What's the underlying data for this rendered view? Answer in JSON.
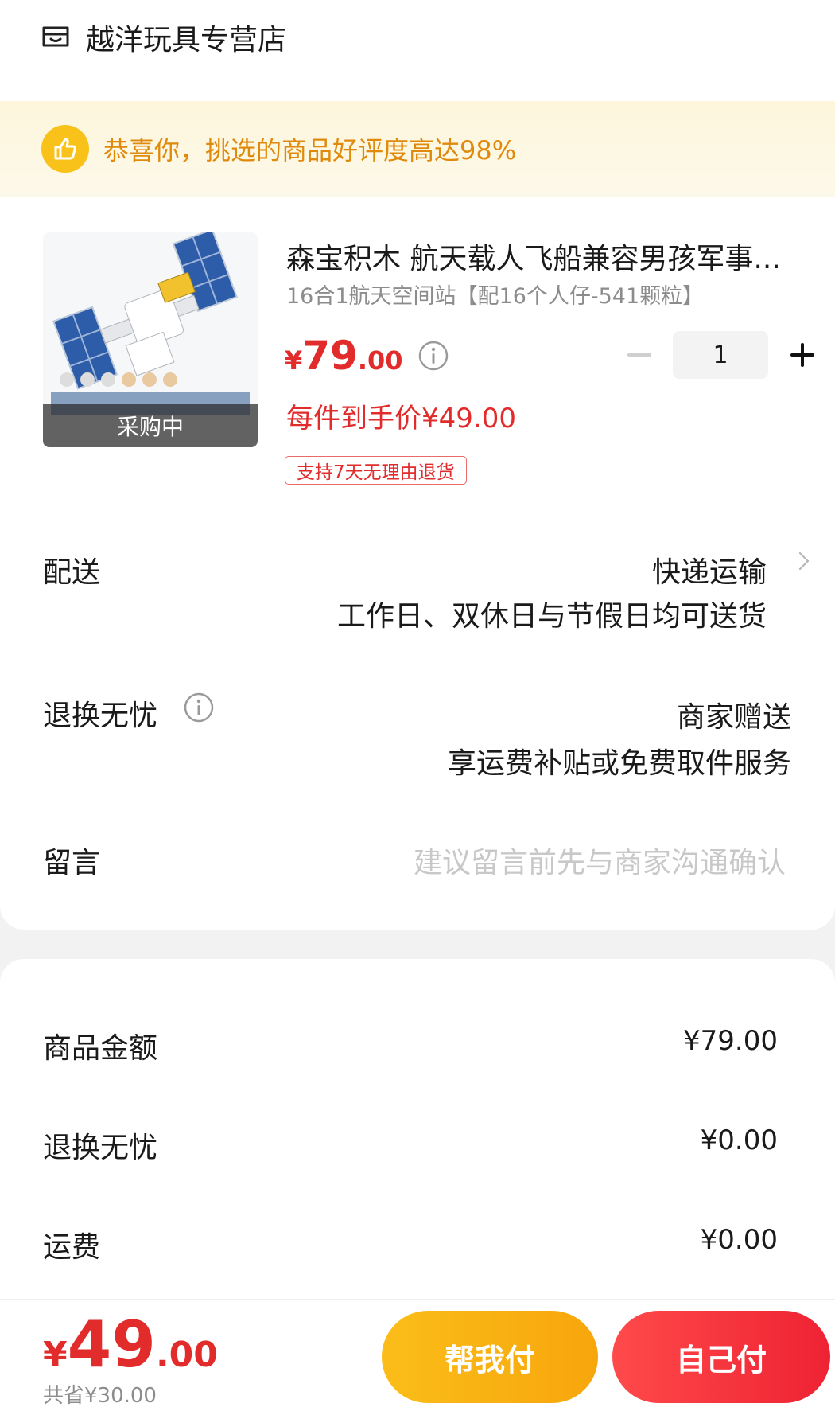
{
  "store": {
    "name": "越洋玩具专营店",
    "icon": "store-icon"
  },
  "banner": {
    "text": "恭喜你，挑选的商品好评度高达98%",
    "icon": "thumbs-up-icon"
  },
  "product": {
    "title": "森宝积木 航天载人飞船兼容男孩军事...",
    "spec": "16合1航天空间站【配16个人仔-541颗粒】",
    "image_status": "采购中",
    "price_currency": "¥",
    "price_int": "79",
    "price_dec": ".00",
    "quantity": "1",
    "net_price": "每件到手价¥49.00",
    "return_tag": "支持7天无理由退货"
  },
  "delivery": {
    "label": "配送",
    "method": "快递运输",
    "note": "工作日、双休日与节假日均可送货"
  },
  "returns": {
    "label": "退换无忧",
    "value": "商家赠送",
    "note": "享运费补贴或免费取件服务"
  },
  "message": {
    "label": "留言",
    "placeholder": "建议留言前先与商家沟通确认"
  },
  "summary": [
    {
      "label": "商品金额",
      "value": "¥79.00"
    },
    {
      "label": "退换无忧",
      "value": "¥0.00"
    },
    {
      "label": "运费",
      "value": "¥0.00"
    }
  ],
  "footer": {
    "total_currency": "¥",
    "total_int": "49",
    "total_dec": ".00",
    "saved": "共省¥30.00",
    "help_pay": "帮我付",
    "self_pay": "自己付"
  },
  "colors": {
    "accent_red": "#e22b2b",
    "accent_orange": "#f9b313",
    "banner_bg": "#fdf6dc"
  }
}
